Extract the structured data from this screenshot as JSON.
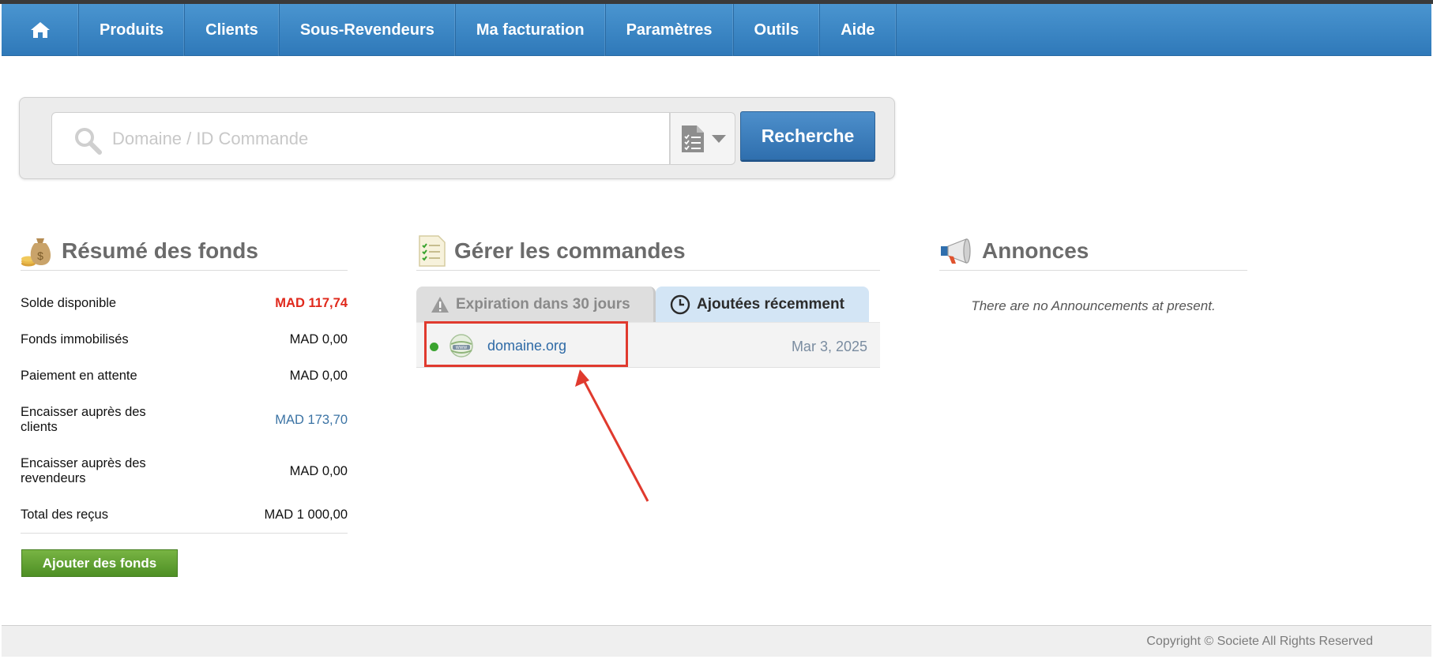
{
  "nav": {
    "home_icon": "home-icon",
    "items": [
      "Produits",
      "Clients",
      "Sous-Revendeurs",
      "Ma facturation",
      "Paramètres",
      "Outils",
      "Aide"
    ]
  },
  "search": {
    "placeholder": "Domaine / ID Commande",
    "value": "",
    "type_icon": "document-checklist-icon",
    "button_label": "Recherche"
  },
  "funds": {
    "title": "Résumé des fonds",
    "icon": "money-bag-icon",
    "rows": [
      {
        "label": "Solde disponible",
        "value": "MAD 117,74",
        "color": "#e0291c"
      },
      {
        "label": "Fonds immobilisés",
        "value": "MAD 0,00"
      },
      {
        "label": "Paiement en attente",
        "value": "MAD 0,00"
      },
      {
        "label": "Encaisser auprès des clients",
        "value": "MAD 173,70",
        "color": "#3b73a4"
      },
      {
        "label": "Encaisser auprès des revendeurs",
        "value": "MAD 0,00"
      },
      {
        "label": "Total des reçus",
        "value": "MAD 1 000,00"
      }
    ],
    "add_button": "Ajouter des fonds"
  },
  "orders": {
    "title": "Gérer les commandes",
    "icon": "document-icon",
    "tabs": [
      {
        "label": "Expiration dans 30 jours",
        "icon": "warning-icon",
        "active": false
      },
      {
        "label": "Ajoutées récemment",
        "icon": "clock-icon",
        "active": true
      }
    ],
    "rows": [
      {
        "domain": "domaine.org",
        "date": "Mar 3, 2025",
        "status_color": "#3aa32f"
      }
    ]
  },
  "announcements": {
    "title": "Annonces",
    "icon": "megaphone-icon",
    "empty_text": "There are no Announcements at present."
  },
  "footer": {
    "copyright": "Copyright © Societe All Rights Reserved"
  }
}
